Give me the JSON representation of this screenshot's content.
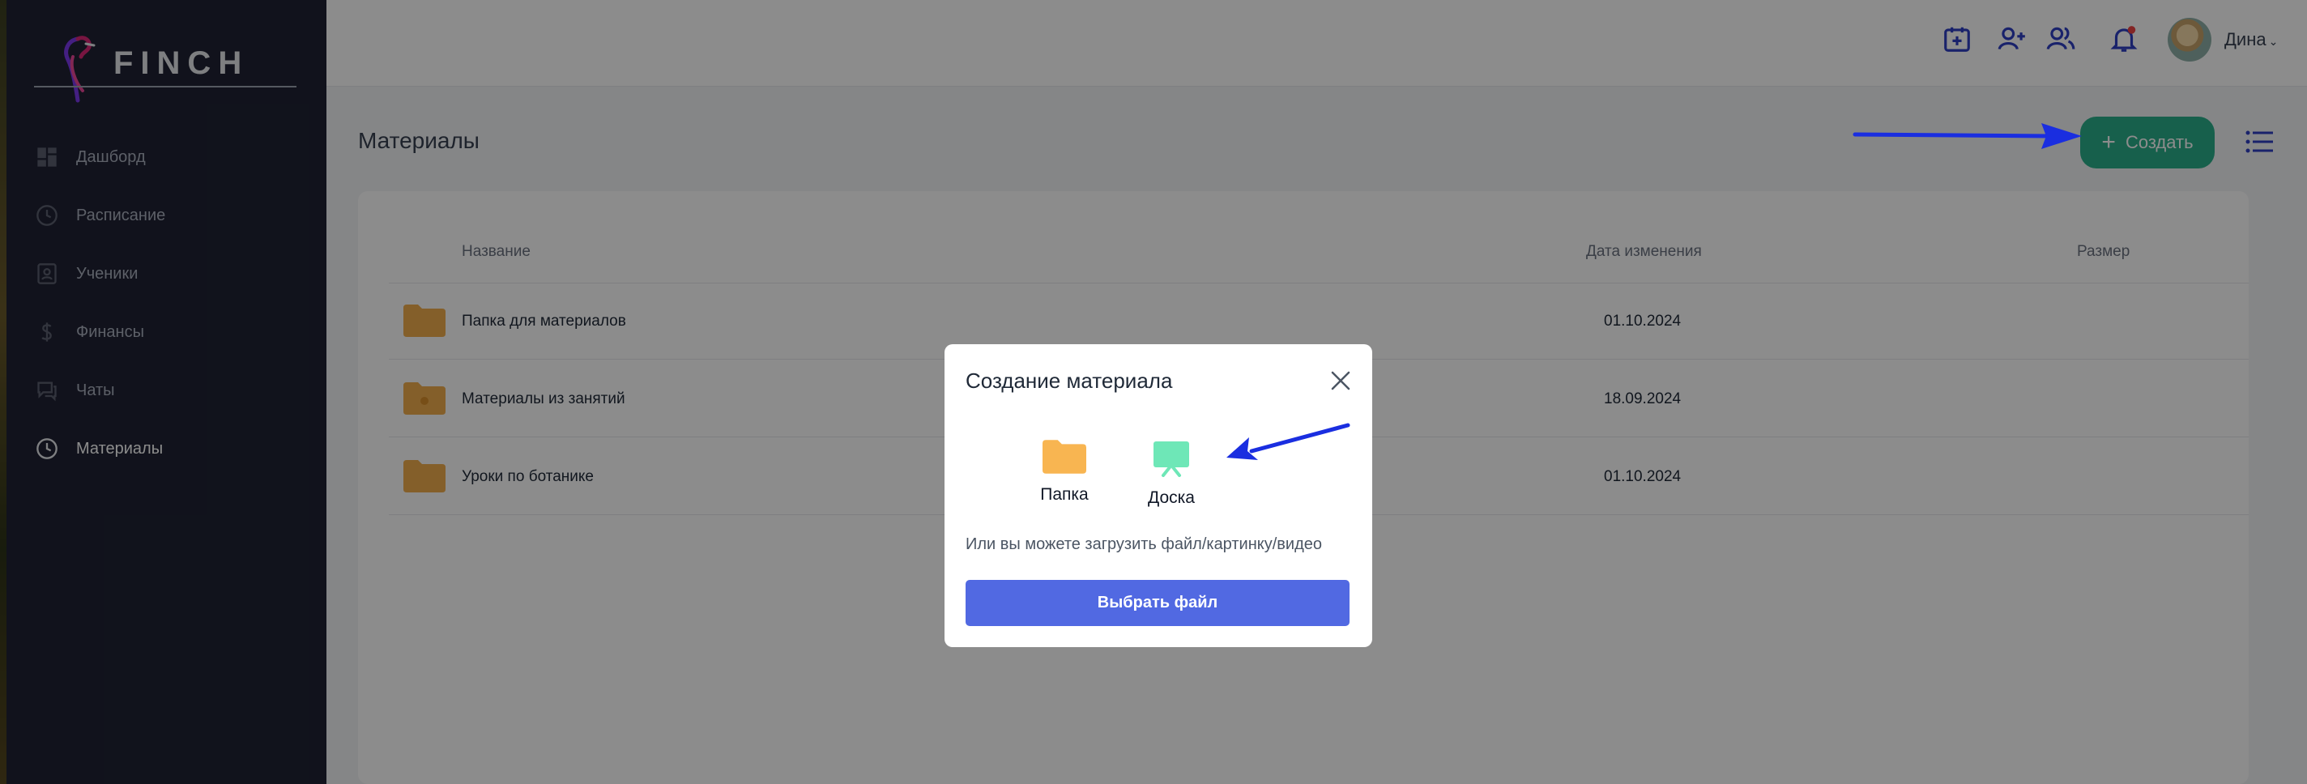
{
  "brand": {
    "name": "FINCH"
  },
  "sidebar": {
    "items": [
      {
        "label": "Дашборд",
        "icon": "dashboard-icon",
        "active": false
      },
      {
        "label": "Расписание",
        "icon": "clock-icon",
        "active": false
      },
      {
        "label": "Ученики",
        "icon": "student-icon",
        "active": false
      },
      {
        "label": "Финансы",
        "icon": "dollar-icon",
        "active": false
      },
      {
        "label": "Чаты",
        "icon": "chat-icon",
        "active": false
      },
      {
        "label": "Материалы",
        "icon": "materials-clock-icon",
        "active": true
      }
    ]
  },
  "header": {
    "icons": [
      "calendar-add-icon",
      "add-user-icon",
      "users-icon",
      "bell-icon"
    ],
    "user_name": "Дина",
    "notification_dot_color": "#ef4444"
  },
  "page": {
    "title": "Материалы",
    "create_label": "Создать"
  },
  "table": {
    "columns": [
      "Название",
      "Дата изменения",
      "Размер"
    ],
    "rows": [
      {
        "name": "Папка для материалов",
        "date": "01.10.2024",
        "size": ""
      },
      {
        "name": "Материалы из занятий",
        "date": "18.09.2024",
        "size": ""
      },
      {
        "name": "Уроки по ботанике",
        "date": "01.10.2024",
        "size": ""
      }
    ]
  },
  "modal": {
    "title": "Создание материала",
    "options": [
      {
        "label": "Папка",
        "icon": "folder-icon"
      },
      {
        "label": "Доска",
        "icon": "board-icon"
      }
    ],
    "hint": "Или вы можете загрузить файл/картинку/видео",
    "choose_file_label": "Выбрать файл"
  },
  "colors": {
    "sidebar_bg": "#1f2233",
    "accent_green": "#2ab08a",
    "accent_blue": "#5169e2",
    "folder": "#f0ad4e",
    "board": "#6ee7b7",
    "annotation_arrow": "#1a2ee0"
  }
}
